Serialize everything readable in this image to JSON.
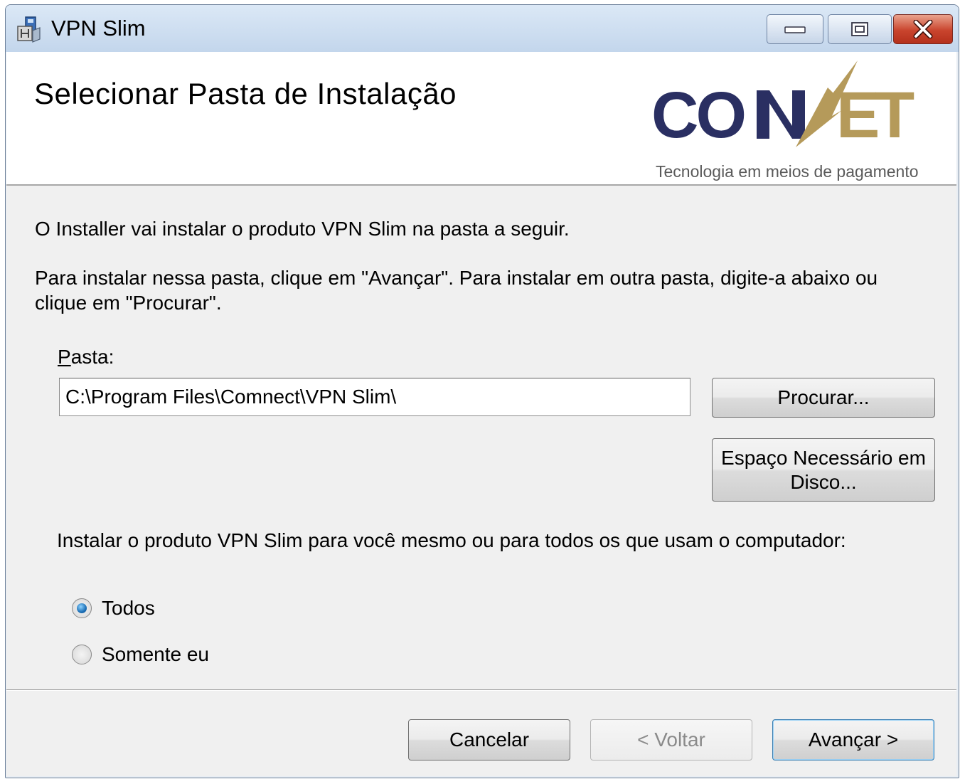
{
  "window": {
    "title": "VPN Slim",
    "icon": "installer-icon"
  },
  "titlebar_buttons": {
    "minimize_icon": "minimize-icon",
    "maximize_icon": "maximize-icon",
    "close_icon": "close-icon"
  },
  "banner": {
    "title": "Selecionar Pasta de Instalação",
    "logo": {
      "brand": "CONNECT",
      "tagline": "Tecnologia em meios de pagamento",
      "brand_color": "#2a2f62",
      "accent_color": "#b59a5a"
    }
  },
  "body": {
    "intro": "O Installer vai instalar o produto VPN Slim na pasta a seguir.",
    "instructions": "Para instalar nessa pasta, clique em \"Avançar\". Para instalar em outra pasta, digite-a abaixo ou clique em \"Procurar\".",
    "folder_label_accesskey": "P",
    "folder_label_rest": "asta:",
    "folder_value": "C:\\Program Files\\Comnect\\VPN Slim\\",
    "browse_button": "Procurar...",
    "disk_cost_button": "Espaço Necessário em Disco...",
    "scope_question": "Instalar o produto VPN Slim para você mesmo ou para todos os que usam o computador:",
    "scope_options": [
      {
        "label": "Todos",
        "checked": true
      },
      {
        "label": "Somente eu",
        "checked": false
      }
    ]
  },
  "footer": {
    "cancel_button": "Cancelar",
    "back_button": "< Voltar",
    "next_button": "Avançar >"
  }
}
